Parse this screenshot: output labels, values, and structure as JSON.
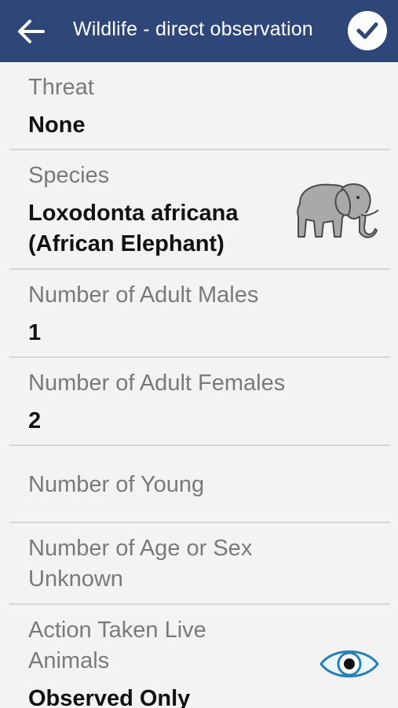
{
  "appbar": {
    "title": "Wildlife - direct observation",
    "back_icon": "arrow-left-icon",
    "confirm_icon": "check-icon",
    "color": "#2f4678"
  },
  "fields": {
    "threat": {
      "label": "Threat",
      "value": "None"
    },
    "species": {
      "label": "Species",
      "value_line1": "Loxodonta africana",
      "value_line2": "(African Elephant)",
      "icon": "elephant-icon"
    },
    "adult_males": {
      "label": "Number of Adult Males",
      "value": "1"
    },
    "adult_females": {
      "label": "Number of Adult Females",
      "value": "2"
    },
    "young": {
      "label": "Number of Young",
      "value": ""
    },
    "unknown": {
      "label_line1": "Number of Age or Sex",
      "label_line2": "Unknown",
      "value": ""
    },
    "action": {
      "label_line1": "Action Taken Live",
      "label_line2": "Animals",
      "value": "Observed Only",
      "icon": "eye-icon"
    }
  }
}
